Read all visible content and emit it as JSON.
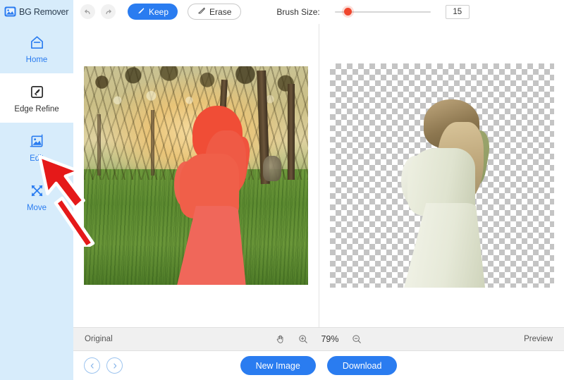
{
  "app": {
    "logo_icon": "image-photo-icon",
    "title": "BG Remover"
  },
  "toolbar": {
    "undo_icon": "undo-arrow-icon",
    "redo_icon": "redo-arrow-icon",
    "keep_label": "Keep",
    "keep_icon": "brush-icon",
    "erase_label": "Erase",
    "erase_icon": "brush-icon",
    "brush_size_label": "Brush Size:",
    "brush_size_value": "15",
    "accent_color": "#2a7cf0",
    "slider_thumb_color": "#f0462d"
  },
  "sidebar": {
    "items": [
      {
        "label": "Home",
        "icon": "home-icon",
        "active": false
      },
      {
        "label": "Edge Refine",
        "icon": "edge-refine-pen-icon",
        "active": true
      },
      {
        "label": "Edit",
        "icon": "edit-image-icon",
        "active": false
      },
      {
        "label": "Move",
        "icon": "move-arrows-icon",
        "active": false
      }
    ],
    "bg_color": "#d7ecfb",
    "label_color": "#2a7cf0"
  },
  "canvas": {
    "left_pane": {
      "name": "original-image-with-red-mask",
      "description": "Woman in long dress standing in a sunlit orchard field, subject area painted with red keep-mask"
    },
    "right_pane": {
      "name": "cutout-preview-transparent",
      "description": "Extracted woman in white dress on transparency checkerboard"
    }
  },
  "statusbar": {
    "left_label": "Original",
    "hand_icon": "hand-pan-icon",
    "zoom_in_icon": "zoom-in-icon",
    "zoom_out_icon": "zoom-out-icon",
    "zoom_value": "79%",
    "right_label": "Preview"
  },
  "footer": {
    "prev_icon": "chevron-left-icon",
    "next_icon": "chevron-right-icon",
    "new_image_label": "New Image",
    "download_label": "Download"
  },
  "cursor": {
    "icon": "red-arrow-pointer",
    "color": "#e02020",
    "points_at": "Edit"
  }
}
